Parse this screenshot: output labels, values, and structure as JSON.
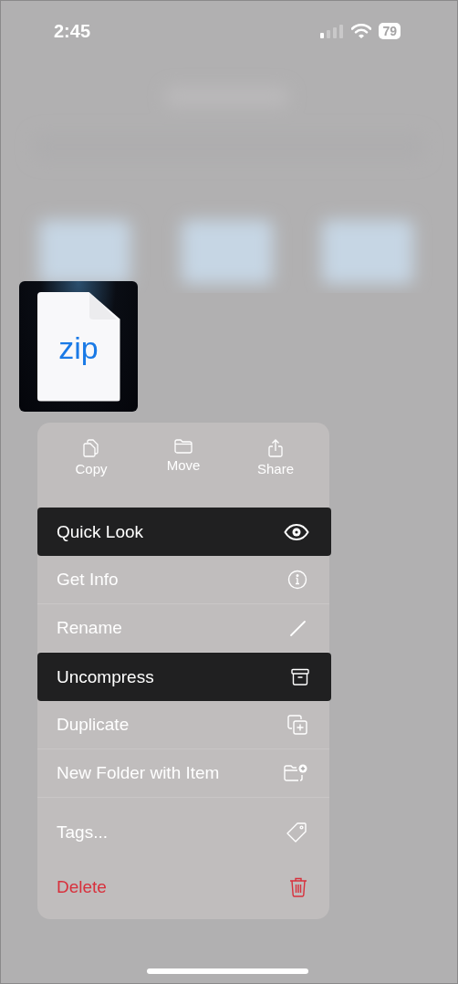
{
  "status_bar": {
    "time": "2:45",
    "battery": "79"
  },
  "preview": {
    "label": "zip"
  },
  "actions": [
    {
      "label": "Copy"
    },
    {
      "label": "Move"
    },
    {
      "label": "Share"
    }
  ],
  "menu_groups": [
    {
      "items": [
        {
          "label": "Quick Look",
          "selected": true,
          "kind": "normal"
        },
        {
          "label": "Get Info",
          "selected": false,
          "kind": "normal"
        },
        {
          "label": "Rename",
          "selected": false,
          "kind": "normal"
        },
        {
          "label": "Uncompress",
          "selected": true,
          "kind": "normal"
        },
        {
          "label": "Duplicate",
          "selected": false,
          "kind": "normal"
        },
        {
          "label": "New Folder with Item",
          "selected": false,
          "kind": "normal"
        }
      ]
    },
    {
      "items": [
        {
          "label": "Tags...",
          "selected": false,
          "kind": "normal"
        },
        {
          "label": "Delete",
          "selected": false,
          "kind": "destructive"
        }
      ]
    }
  ]
}
